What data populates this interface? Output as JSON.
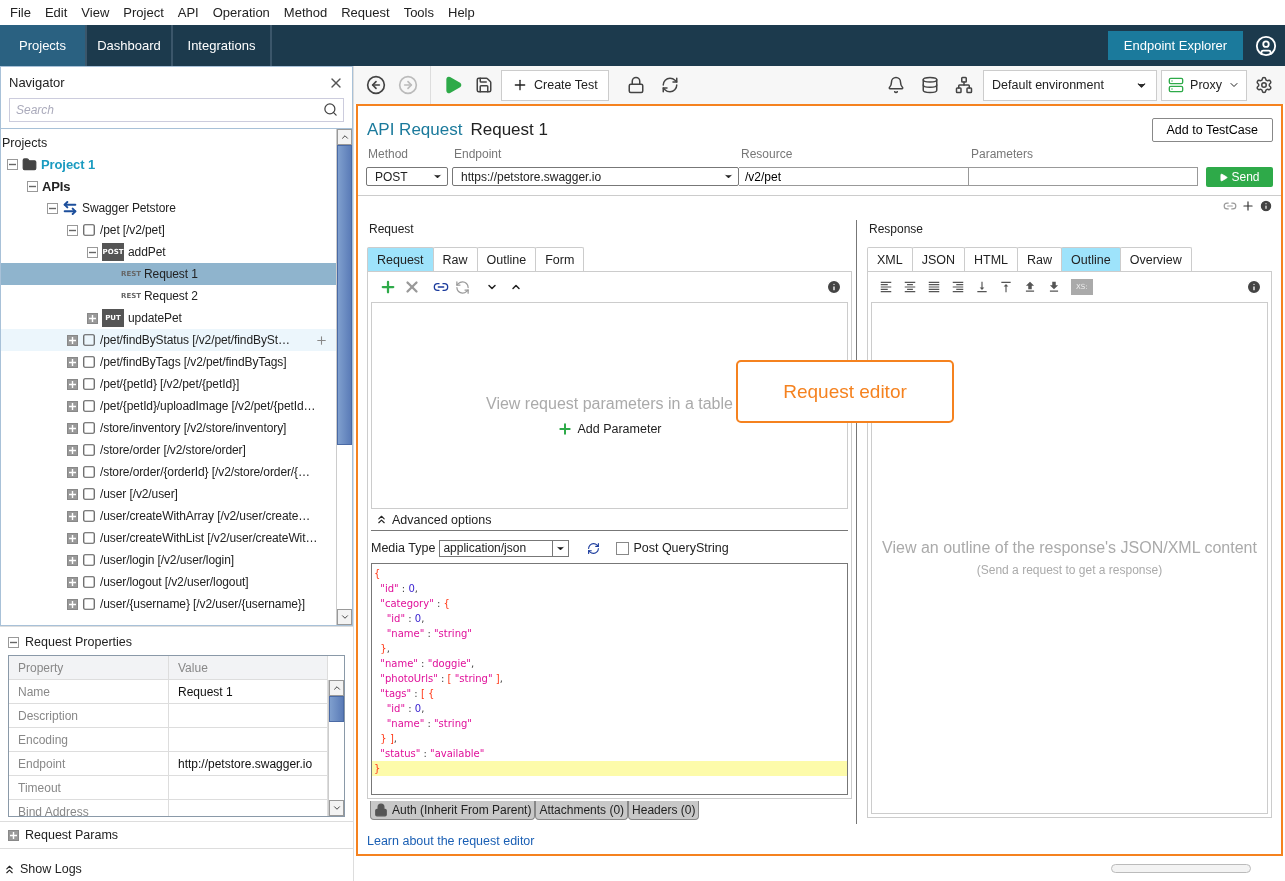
{
  "menu": [
    "File",
    "Edit",
    "View",
    "Project",
    "API",
    "Operation",
    "Method",
    "Request",
    "Tools",
    "Help"
  ],
  "nav_tabs": [
    {
      "label": "Projects",
      "selected": true
    },
    {
      "label": "Dashboard",
      "selected": false
    },
    {
      "label": "Integrations",
      "selected": false
    }
  ],
  "endpoint_explorer_button": "Endpoint Explorer",
  "navigator": {
    "title": "Navigator",
    "search": {
      "placeholder": "Search"
    },
    "tree_heading": "Projects",
    "tree": [
      {
        "label": "Project 1",
        "kind": "project",
        "expanded": true,
        "selected": false,
        "children": [
          {
            "label": "APIs",
            "kind": "group",
            "expanded": true,
            "selected": false,
            "children": [
              {
                "label": "Swagger Petstore",
                "kind": "service",
                "expanded": true,
                "selected": false,
                "children": [
                  {
                    "label": "/pet [/v2/pet]",
                    "kind": "resource",
                    "expanded": true,
                    "selected": false,
                    "children": [
                      {
                        "label": "addPet",
                        "kind": "method",
                        "badge": "POST",
                        "expanded": true,
                        "selected": false,
                        "children": [
                          {
                            "label": "Request 1",
                            "kind": "request",
                            "badge": "REST",
                            "selected": true
                          },
                          {
                            "label": "Request 2",
                            "kind": "request",
                            "badge": "REST",
                            "selected": false
                          }
                        ]
                      },
                      {
                        "label": "updatePet",
                        "kind": "method",
                        "badge": "PUT",
                        "expanded": false,
                        "selected": false
                      }
                    ]
                  },
                  {
                    "label": "/pet/findByStatus [/v2/pet/findBySt…",
                    "kind": "resource",
                    "expanded": false,
                    "selected": false,
                    "hovered": true
                  },
                  {
                    "label": "/pet/findByTags [/v2/pet/findByTags]",
                    "kind": "resource",
                    "expanded": false,
                    "selected": false
                  },
                  {
                    "label": "/pet/{petId} [/v2/pet/{petId}]",
                    "kind": "resource",
                    "expanded": false,
                    "selected": false
                  },
                  {
                    "label": "/pet/{petId}/uploadImage [/v2/pet/{petId…",
                    "kind": "resource",
                    "expanded": false,
                    "selected": false
                  },
                  {
                    "label": "/store/inventory [/v2/store/inventory]",
                    "kind": "resource",
                    "expanded": false,
                    "selected": false
                  },
                  {
                    "label": "/store/order [/v2/store/order]",
                    "kind": "resource",
                    "expanded": false,
                    "selected": false
                  },
                  {
                    "label": "/store/order/{orderId} [/v2/store/order/{…",
                    "kind": "resource",
                    "expanded": false,
                    "selected": false
                  },
                  {
                    "label": "/user [/v2/user]",
                    "kind": "resource",
                    "expanded": false,
                    "selected": false
                  },
                  {
                    "label": "/user/createWithArray [/v2/user/create…",
                    "kind": "resource",
                    "expanded": false,
                    "selected": false
                  },
                  {
                    "label": "/user/createWithList [/v2/user/createWit…",
                    "kind": "resource",
                    "expanded": false,
                    "selected": false
                  },
                  {
                    "label": "/user/login [/v2/user/login]",
                    "kind": "resource",
                    "expanded": false,
                    "selected": false
                  },
                  {
                    "label": "/user/logout [/v2/user/logout]",
                    "kind": "resource",
                    "expanded": false,
                    "selected": false
                  },
                  {
                    "label": "/user/{username} [/v2/user/{username}]",
                    "kind": "resource",
                    "expanded": false,
                    "selected": false
                  }
                ]
              }
            ]
          }
        ]
      }
    ]
  },
  "request_properties": {
    "title": "Request Properties",
    "expanded": true,
    "columns": [
      "Property",
      "Value"
    ],
    "rows": [
      {
        "property": "Name",
        "value": "Request 1"
      },
      {
        "property": "Description"
      },
      {
        "property": "Encoding"
      },
      {
        "property": "Endpoint",
        "value": "http://petstore.swagger.io"
      },
      {
        "property": "Timeout"
      },
      {
        "property": "Bind Address"
      }
    ]
  },
  "request_params": {
    "title": "Request Params",
    "expanded": false
  },
  "show_logs": "Show Logs",
  "toolbar": {
    "create_test": "Create Test",
    "environment": "Default environment",
    "proxy": "Proxy"
  },
  "editor": {
    "kind_label": "API Request",
    "title": "Request 1",
    "add_to_testcase": "Add to TestCase",
    "fields": {
      "method": {
        "label": "Method",
        "value": "POST"
      },
      "endpoint": {
        "label": "Endpoint",
        "value": "https://petstore.swagger.io"
      },
      "resource": {
        "label": "Resource",
        "value": "/v2/pet"
      },
      "parameters": {
        "label": "Parameters"
      }
    },
    "send": "Send",
    "request": {
      "heading": "Request",
      "tabs": [
        {
          "label": "Request",
          "selected": true
        },
        {
          "label": "Raw",
          "selected": false
        },
        {
          "label": "Outline",
          "selected": false
        },
        {
          "label": "Form",
          "selected": false
        }
      ],
      "empty_text": "View request parameters in a table",
      "add_parameter": "Add Parameter",
      "advanced_options": {
        "label": "Advanced options",
        "expanded": true
      },
      "media_type": {
        "label": "Media Type",
        "value": "application/json"
      },
      "post_querystring": {
        "label": "Post QueryString",
        "checked": false
      },
      "code": [
        {
          "text": "{"
        },
        {
          "text": "  \"id\" : 0,"
        },
        {
          "text": "  \"category\" : {"
        },
        {
          "text": "    \"id\" : 0,"
        },
        {
          "text": "    \"name\" : \"string\""
        },
        {
          "text": "  },"
        },
        {
          "text": "  \"name\" : \"doggie\","
        },
        {
          "text": "  \"photoUrls\" : [ \"string\" ],"
        },
        {
          "text": "  \"tags\" : [ {"
        },
        {
          "text": "    \"id\" : 0,"
        },
        {
          "text": "    \"name\" : \"string\""
        },
        {
          "text": "  } ],"
        },
        {
          "text": "  \"status\" : \"available\""
        },
        {
          "text": "}",
          "highlighted": true
        }
      ],
      "bottom_tabs": [
        {
          "label": "Auth (Inherit From Parent)",
          "kind": "auth"
        },
        {
          "label": "Attachments (0)",
          "kind": "plain"
        },
        {
          "label": "Headers (0)",
          "kind": "plain"
        }
      ]
    },
    "response": {
      "heading": "Response",
      "tabs": [
        {
          "label": "XML",
          "selected": false
        },
        {
          "label": "JSON",
          "selected": false
        },
        {
          "label": "HTML",
          "selected": false
        },
        {
          "label": "Raw",
          "selected": false
        },
        {
          "label": "Outline",
          "selected": true
        },
        {
          "label": "Overview",
          "selected": false
        }
      ],
      "xsd_button": "XS:",
      "empty_text": "View an outline of the response's JSON/XML content",
      "empty_hint": "(Send a request to get a response)"
    },
    "learn_link": "Learn about the request editor"
  },
  "callout": "Request editor"
}
